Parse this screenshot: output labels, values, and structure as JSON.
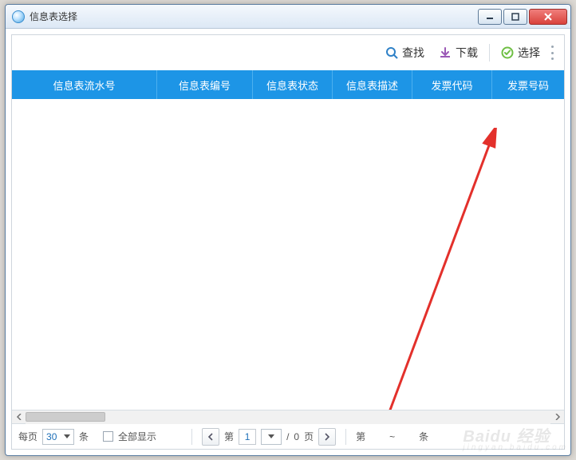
{
  "window": {
    "title": "信息表选择"
  },
  "toolbar": {
    "search_label": "查找",
    "download_label": "下载",
    "select_label": "选择"
  },
  "table": {
    "headers": [
      "信息表流水号",
      "信息表编号",
      "信息表状态",
      "信息表描述",
      "发票代码",
      "发票号码"
    ]
  },
  "pager": {
    "per_page_prefix": "每页",
    "per_page_value": "30",
    "per_page_suffix": "条",
    "show_all_label": "全部显示",
    "page_label_prefix": "第",
    "current_page": "1",
    "total_pages": "0",
    "page_label_suffix": "页",
    "slash": "/",
    "record_prefix": "第",
    "record_sep": "~",
    "record_suffix": "条"
  },
  "watermark": {
    "main": "Baidu 经验",
    "sub": "jingyan.baidu.com"
  },
  "colors": {
    "accent": "#1d95e6",
    "download_icon": "#9b59b6",
    "select_icon": "#6fbf44",
    "search_icon": "#2f81c7"
  }
}
